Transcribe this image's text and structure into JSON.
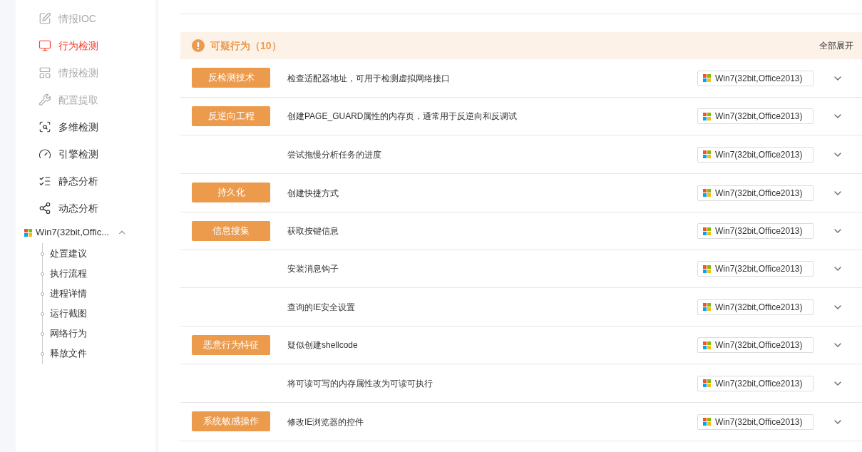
{
  "sidebar": {
    "items": [
      {
        "label": "情报IOC",
        "selected": false,
        "disabled": true
      },
      {
        "label": "行为检测",
        "selected": true,
        "disabled": false
      },
      {
        "label": "情报检测",
        "selected": false,
        "disabled": true
      },
      {
        "label": "配置提取",
        "selected": false,
        "disabled": true
      },
      {
        "label": "多维检测",
        "selected": false,
        "disabled": false
      },
      {
        "label": "引擎检测",
        "selected": false,
        "disabled": false
      },
      {
        "label": "静态分析",
        "selected": false,
        "disabled": false
      },
      {
        "label": "动态分析",
        "selected": false,
        "disabled": false,
        "children": [
          {
            "label": "Win7(32bit,Offic...",
            "expanded": true,
            "children": [
              {
                "label": "处置建议"
              },
              {
                "label": "执行流程"
              },
              {
                "label": "进程详情"
              },
              {
                "label": "运行截图"
              },
              {
                "label": "网络行为"
              },
              {
                "label": "释放文件"
              }
            ]
          }
        ]
      }
    ]
  },
  "section": {
    "title": "可疑行为（10）",
    "expand_all": "全部展开",
    "groups": [
      {
        "category": "反检测技术",
        "rows": [
          {
            "text": "检查适配器地址，可用于检测虚拟网络接口",
            "env": "Win7(32bit,Office2013)",
            "expanded": false
          }
        ]
      },
      {
        "category": "反逆向工程",
        "rows": [
          {
            "text": "创建PAGE_GUARD属性的内存页，通常用于反逆向和反调试",
            "env": "Win7(32bit,Office2013)",
            "expanded": false
          },
          {
            "text": "尝试拖慢分析任务的进度",
            "env": "Win7(32bit,Office2013)",
            "expanded": false
          }
        ]
      },
      {
        "category": "持久化",
        "rows": [
          {
            "text": "创建快捷方式",
            "env": "Win7(32bit,Office2013)",
            "expanded": false
          }
        ]
      },
      {
        "category": "信息搜集",
        "rows": [
          {
            "text": "获取按键信息",
            "env": "Win7(32bit,Office2013)",
            "expanded": false
          },
          {
            "text": "安装消息钩子",
            "env": "Win7(32bit,Office2013)",
            "expanded": false
          },
          {
            "text": "查询的IE安全设置",
            "env": "Win7(32bit,Office2013)",
            "expanded": false
          }
        ]
      },
      {
        "category": "恶意行为特征",
        "rows": [
          {
            "text": "疑似创建shellcode",
            "env": "Win7(32bit,Office2013)",
            "expanded": false
          },
          {
            "text": "将可读可写的内存属性改为可读可执行",
            "env": "Win7(32bit,Office2013)",
            "expanded": false
          }
        ]
      },
      {
        "category": "系统敏感操作",
        "rows": [
          {
            "text": "修改IE浏览器的控件",
            "env": "Win7(32bit,Office2013)",
            "expanded": false
          }
        ]
      }
    ]
  }
}
